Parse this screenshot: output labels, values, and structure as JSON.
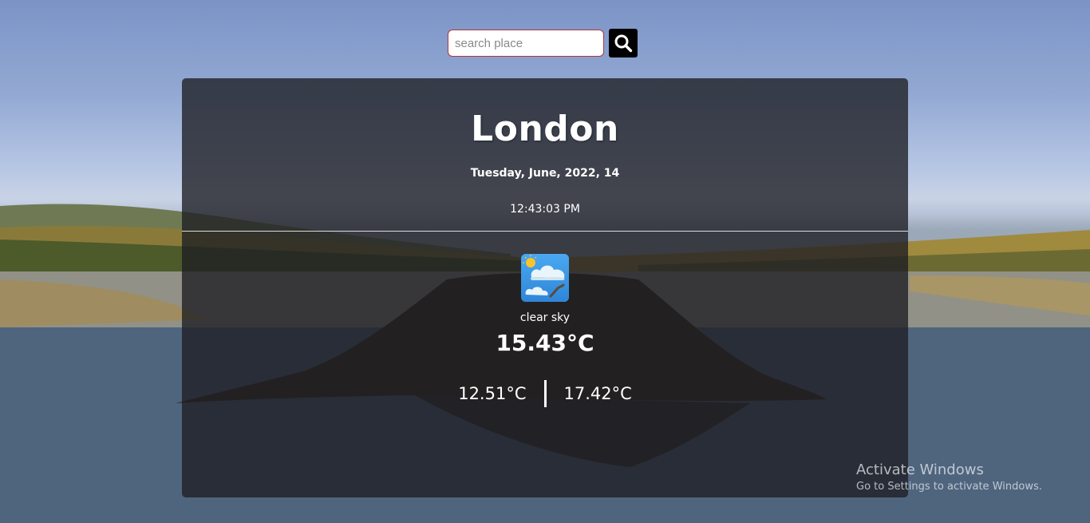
{
  "search": {
    "placeholder": "search place",
    "value": "",
    "button_icon": "search-icon"
  },
  "weather": {
    "city": "London",
    "date": "Tuesday, June, 2022, 14",
    "time": "12:43:03 PM",
    "icon": "sun-behind-clouds-icon",
    "description": "clear sky",
    "temperature": "15.43°C",
    "temp_min": "12.51°C",
    "temp_max": "17.42°C"
  },
  "watermark": {
    "title": "Activate Windows",
    "subtitle": "Go to Settings to activate Windows."
  },
  "colors": {
    "search_border": "#b0353f",
    "search_button": "#000000",
    "card_background": "rgba(30,30,34,0.78)",
    "text": "#ffffff"
  }
}
